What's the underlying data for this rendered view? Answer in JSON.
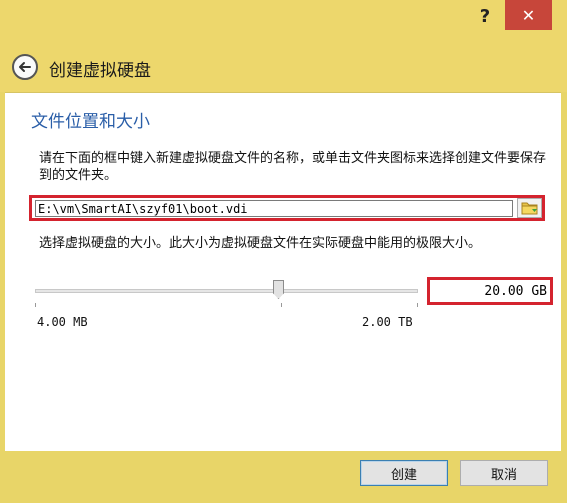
{
  "window": {
    "help_label": "?",
    "close_label": "✕"
  },
  "header": {
    "title": "创建虚拟硬盘",
    "back_icon": "back-arrow-icon"
  },
  "section": {
    "title": "文件位置和大小",
    "location_description": "请在下面的框中键入新建虚拟硬盘文件的名称，或单击文件夹图标来选择创建文件要保存到的文件夹。",
    "file_path": "E:\\vm\\SmartAI\\szyf01\\boot.vdi",
    "size_description": "选择虚拟硬盘的大小。此大小为虚拟硬盘文件在实际硬盘中能用的极限大小。",
    "size_value": "20.00 GB",
    "slider_min_label": "4.00 MB",
    "slider_max_label": "2.00 TB",
    "slider_position": 0.64
  },
  "footer": {
    "create_label": "创建",
    "cancel_label": "取消"
  },
  "colors": {
    "accent": "#2a5ea8",
    "highlight": "#d4232e",
    "frame": "#edd76c",
    "close": "#c7463a"
  }
}
